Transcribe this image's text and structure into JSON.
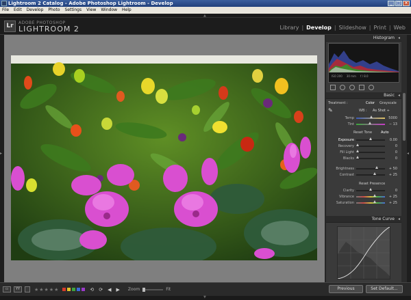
{
  "window": {
    "title": "Lightroom 2 Catalog - Adobe Photoshop Lightroom - Develop"
  },
  "menu": [
    "File",
    "Edit",
    "Develop",
    "Photo",
    "Settings",
    "View",
    "Window",
    "Help"
  ],
  "identity": {
    "logo": "Lr",
    "small": "ADOBE PHOTOSHOP",
    "big": "LIGHTROOM 2"
  },
  "modules": [
    "Library",
    "Develop",
    "Slideshow",
    "Print",
    "Web"
  ],
  "active_module": "Develop",
  "panels": {
    "histogram": {
      "title": "Histogram",
      "iso": "ISO 200",
      "focal": "30 mm",
      "aperture": "f / 8.0",
      "shutter": "1/100 sec"
    },
    "basic": {
      "title": "Basic",
      "treatment_label": "Treatment :",
      "color": "Color",
      "grayscale": "Grayscale",
      "wb_label": "WB :",
      "wb_value": "As Shot ÷",
      "temp_label": "Temp",
      "temp_value": "5000",
      "tint_label": "Tint",
      "tint_value": "− 13",
      "tone_label": "Reset Tone",
      "auto": "Auto",
      "exposure": "Exposure",
      "exposure_v": "0.00",
      "recovery": "Recovery",
      "recovery_v": "0",
      "fill": "Fill Light",
      "fill_v": "0",
      "blacks": "Blacks",
      "blacks_v": "0",
      "brightness": "Brightness",
      "brightness_v": "+ 50",
      "contrast": "Contrast",
      "contrast_v": "+ 25",
      "presence_label": "Reset Presence",
      "clarity": "Clarity",
      "clarity_v": "0",
      "vibrance": "Vibrance",
      "vibrance_v": "+ 25",
      "saturation": "Saturation",
      "saturation_v": "+ 25"
    },
    "tone_curve": {
      "title": "Tone Curve"
    }
  },
  "bottom": {
    "zoom_label": "Zoom",
    "zoom_value": "Fit",
    "previous": "Previous",
    "set_default": "Set Default...",
    "view_icon": "YY",
    "loupe_icon": "▭"
  },
  "colors": {
    "accent_label": "#e06020",
    "flags": [
      "#d43a2a",
      "#e2c02a",
      "#3ea23e",
      "#3a6ad8",
      "#9a3ac8"
    ]
  }
}
